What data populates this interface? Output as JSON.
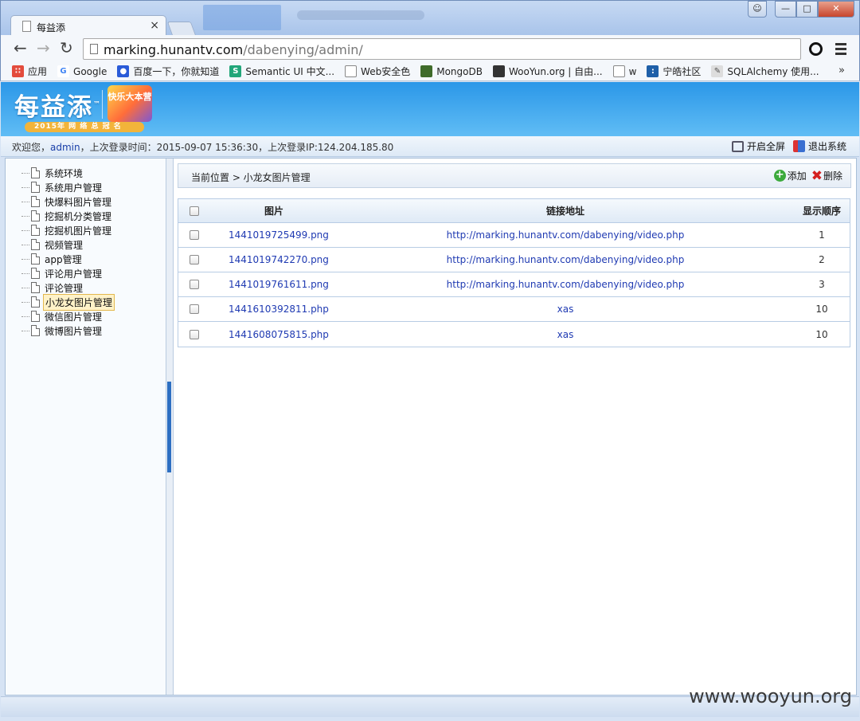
{
  "browser": {
    "tab_title": "每益添",
    "tab_close": "×",
    "url_host": "marking.hunantv.com",
    "url_path": "/dabenying/admin/",
    "bookmarks": [
      {
        "label": "应用",
        "icon": "apps-grid-icon",
        "color": "#e34b3c"
      },
      {
        "label": "Google",
        "icon": "google-icon",
        "color": "#4285f4"
      },
      {
        "label": "百度一下，你就知道",
        "icon": "baidu-paw-icon",
        "color": "#2a5bd8"
      },
      {
        "label": "Semantic UI 中文...",
        "icon": "semantic-s-icon",
        "color": "#22a67a"
      },
      {
        "label": "Web安全色",
        "icon": "page-icon",
        "color": "#ffffff"
      },
      {
        "label": "MongoDB",
        "icon": "mongodb-leaf-icon",
        "color": "#3f6b2a"
      },
      {
        "label": "WooYun.org | 自由...",
        "icon": "wooyun-icon",
        "color": "#333333"
      },
      {
        "label": "w",
        "icon": "page-icon",
        "color": "#ffffff"
      },
      {
        "label": "宁皓社区",
        "icon": "ninghao-icon",
        "color": "#1e5fa8"
      },
      {
        "label": "SQLAlchemy 使用...",
        "icon": "pen-icon",
        "color": "#777777"
      }
    ],
    "bookmarks_more": "»"
  },
  "header": {
    "logo_text": "每益添",
    "logo_tm": "™",
    "logo_sub": "2015年 网 络 总 冠 名",
    "badge_text": "快乐大本营"
  },
  "info": {
    "welcome_prefix": "欢迎您，",
    "username": "admin",
    "welcome_suffix": "，上次登录时间：2015-09-07 15:36:30，上次登录IP:124.204.185.80",
    "fullscreen_label": "开启全屏",
    "logout_label": "退出系统"
  },
  "sidebar": {
    "items": [
      {
        "label": "系统环境",
        "active": false
      },
      {
        "label": "系统用户管理",
        "active": false
      },
      {
        "label": "快爆料图片管理",
        "active": false
      },
      {
        "label": "挖掘机分类管理",
        "active": false
      },
      {
        "label": "挖掘机图片管理",
        "active": false
      },
      {
        "label": "视频管理",
        "active": false
      },
      {
        "label": "app管理",
        "active": false
      },
      {
        "label": "评论用户管理",
        "active": false
      },
      {
        "label": "评论管理",
        "active": false
      },
      {
        "label": "小龙女图片管理",
        "active": true
      },
      {
        "label": "微信图片管理",
        "active": false
      },
      {
        "label": "微博图片管理",
        "active": false
      }
    ]
  },
  "main": {
    "breadcrumb": "当前位置 > 小龙女图片管理",
    "add_label": "添加",
    "delete_label": "删除",
    "table": {
      "columns": [
        "图片",
        "链接地址",
        "显示顺序"
      ],
      "rows": [
        {
          "image": "1441019725499.png",
          "link": "http://marking.hunantv.com/dabenying/video.php",
          "order": "1"
        },
        {
          "image": "1441019742270.png",
          "link": "http://marking.hunantv.com/dabenying/video.php",
          "order": "2"
        },
        {
          "image": "1441019761611.png",
          "link": "http://marking.hunantv.com/dabenying/video.php",
          "order": "3"
        },
        {
          "image": "1441610392811.php",
          "link": "xas",
          "order": "10"
        },
        {
          "image": "1441608075815.php",
          "link": "xas",
          "order": "10"
        }
      ]
    }
  },
  "watermark": "www.wooyun.org"
}
